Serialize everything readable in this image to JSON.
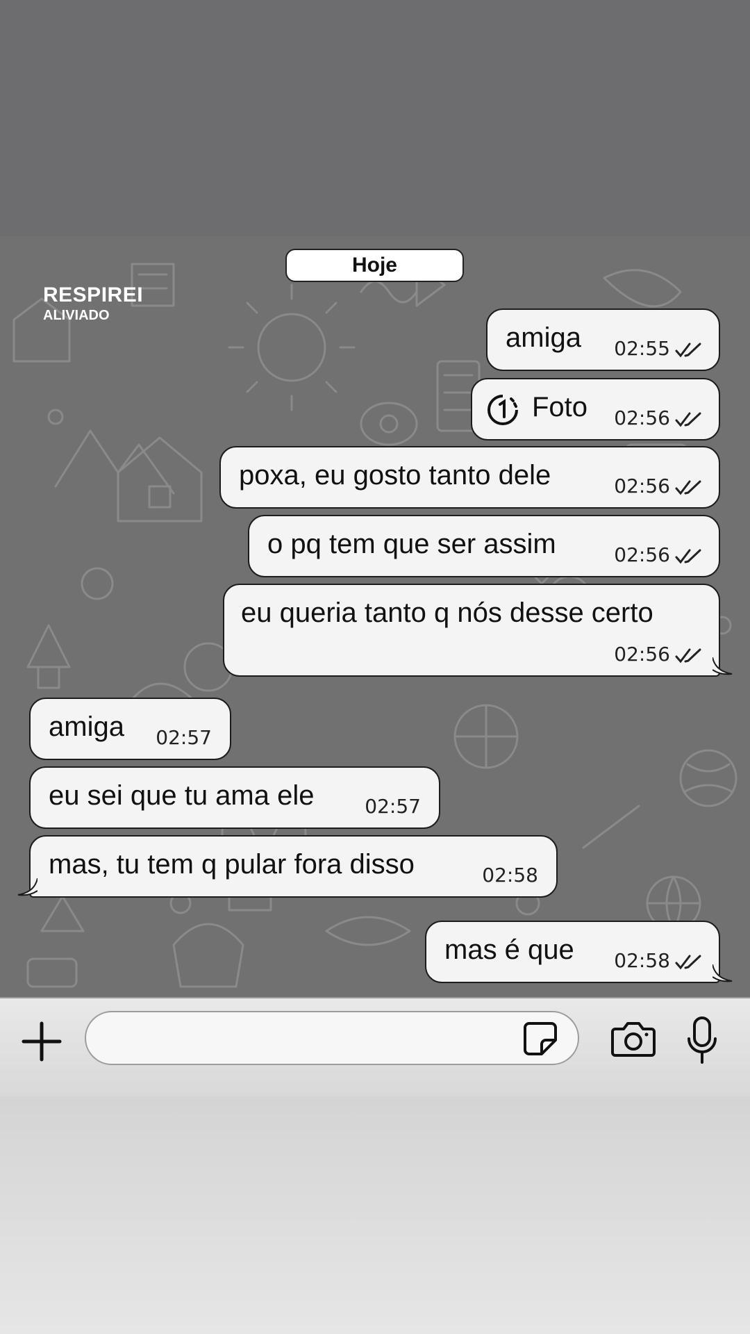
{
  "brand": {
    "title": "RESPIREI",
    "subtitle": "ALIVIADO"
  },
  "date_separator": "Hoje",
  "messages": [
    {
      "direction": "outgoing",
      "text": "amiga",
      "time": "02:55",
      "status": "read"
    },
    {
      "direction": "outgoing",
      "type": "photo",
      "icon": "view-once-icon",
      "text": "Foto",
      "time": "02:56",
      "status": "read"
    },
    {
      "direction": "outgoing",
      "text": "poxa, eu gosto tanto dele",
      "time": "02:56",
      "status": "read"
    },
    {
      "direction": "outgoing",
      "text": "o pq tem que ser assim",
      "time": "02:56",
      "status": "read"
    },
    {
      "direction": "outgoing",
      "text": "eu queria tanto q nós desse certo",
      "time": "02:56",
      "status": "read"
    },
    {
      "direction": "incoming",
      "text": "amiga",
      "time": "02:57"
    },
    {
      "direction": "incoming",
      "text": "eu sei que tu ama ele",
      "time": "02:57"
    },
    {
      "direction": "incoming",
      "text": "mas, tu tem q pular fora disso",
      "time": "02:58"
    },
    {
      "direction": "outgoing",
      "text": "mas é que",
      "time": "02:58",
      "status": "read"
    }
  ],
  "input_bar": {
    "icons": [
      "plus-icon",
      "sticker-icon",
      "camera-icon",
      "microphone-icon"
    ],
    "field_value": ""
  },
  "colors": {
    "chat_background": "#717171",
    "bubble": "#f4f4f4",
    "top_band": "#6d6d6f"
  }
}
